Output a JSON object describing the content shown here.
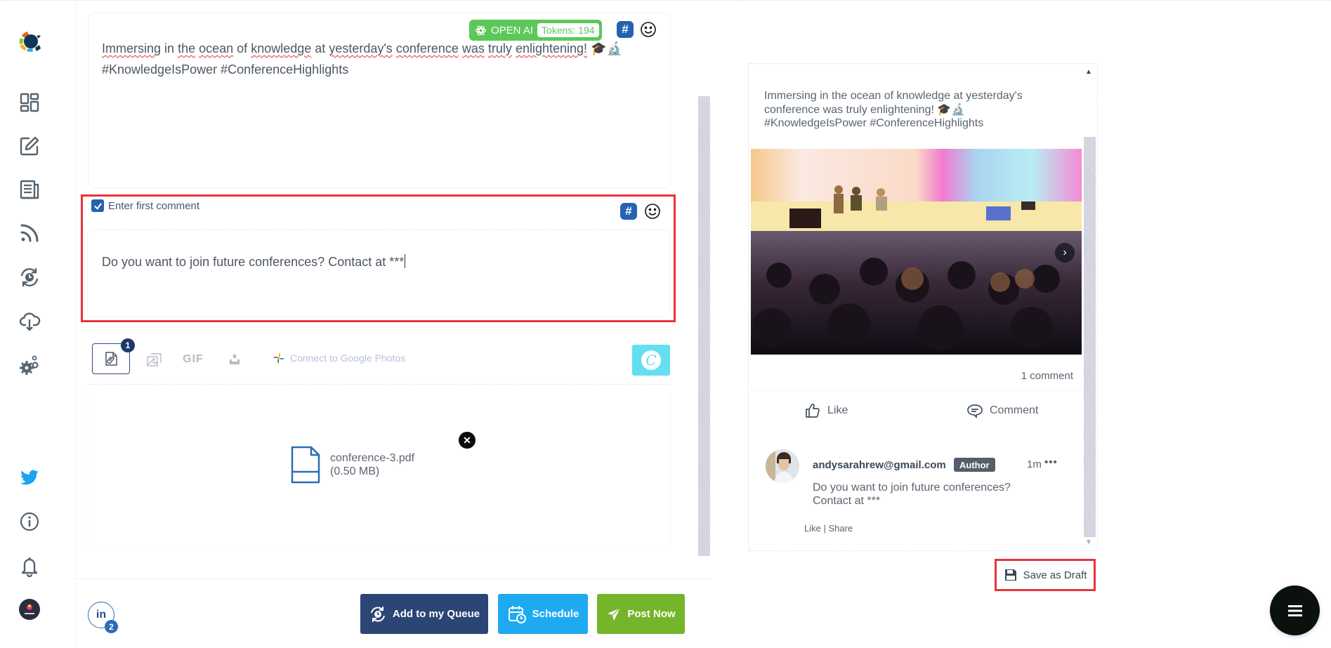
{
  "sidebar": {
    "logo": "app-logo",
    "items": [
      {
        "name": "dashboard",
        "icon": "dashboard-icon"
      },
      {
        "name": "compose",
        "icon": "compose-icon"
      },
      {
        "name": "content",
        "icon": "newspaper-icon"
      },
      {
        "name": "rss-feeds",
        "icon": "rss-icon"
      },
      {
        "name": "queue",
        "icon": "queue-clock-icon"
      },
      {
        "name": "cloud-import",
        "icon": "cloud-download-icon"
      },
      {
        "name": "settings",
        "icon": "gears-icon"
      }
    ],
    "bottom_items": [
      {
        "name": "twitter",
        "icon": "twitter-icon"
      },
      {
        "name": "info",
        "icon": "info-icon"
      },
      {
        "name": "notifications",
        "icon": "bell-icon"
      },
      {
        "name": "account",
        "icon": "avatar"
      }
    ]
  },
  "editor": {
    "post_line1_words": [
      "Immersing",
      "in",
      "the",
      "ocean",
      "of",
      "knowledge",
      "at",
      "yesterday's",
      "conference",
      "was",
      "truly",
      "enlightening!"
    ],
    "post_line1_emojis": "🎓🔬",
    "post_line2": "#KnowledgeIsPower #ConferenceHighlights",
    "openai_label": "OPEN AI",
    "tokens_label": "Tokens: 194",
    "hashtag_symbol": "#",
    "emoji_symbol": "☺"
  },
  "first_comment": {
    "checkbox_label": "Enter first comment",
    "checked": true,
    "text": "Do you want to join future conferences? Contact at ***"
  },
  "media_toolbar": {
    "attachment_count": "1",
    "gif_label": "GIF",
    "google_photos_label": "Connect to Google Photos",
    "canva_label": "C"
  },
  "attachment": {
    "file_name": "conference-3.pdf",
    "file_size": "(0.50 MB)",
    "remove_symbol": "✕"
  },
  "footer": {
    "account_network": "in",
    "account_count": "2",
    "queue_button": "Add to my Queue",
    "schedule_button": "Schedule",
    "post_button": "Post Now",
    "colors": {
      "queue": "#2b4575",
      "schedule": "#1eaaf1",
      "post": "#75b52a"
    }
  },
  "preview": {
    "post_text_line1": "Immersing in the ocean of knowledge at yesterday's",
    "post_text_line2": "conference was truly enlightening! 🎓🔬",
    "post_text_line3": "#KnowledgeIsPower #ConferenceHighlights",
    "image_alt": "Audience at a conference watching a panel on stage",
    "next_symbol": "›",
    "comment_count": "1 comment",
    "like_label": "Like",
    "comment_label": "Comment",
    "comment": {
      "author": "andysarahrew@gmail.com",
      "badge": "Author",
      "time": "1m",
      "more": "•••",
      "text_line1": "Do you want to join future conferences?",
      "text_line2": "Contact at ***",
      "like_action": "Like",
      "separator": " | ",
      "share_action": "Share"
    }
  },
  "save_draft_label": "Save as Draft",
  "fab_icon": "menu-icon"
}
